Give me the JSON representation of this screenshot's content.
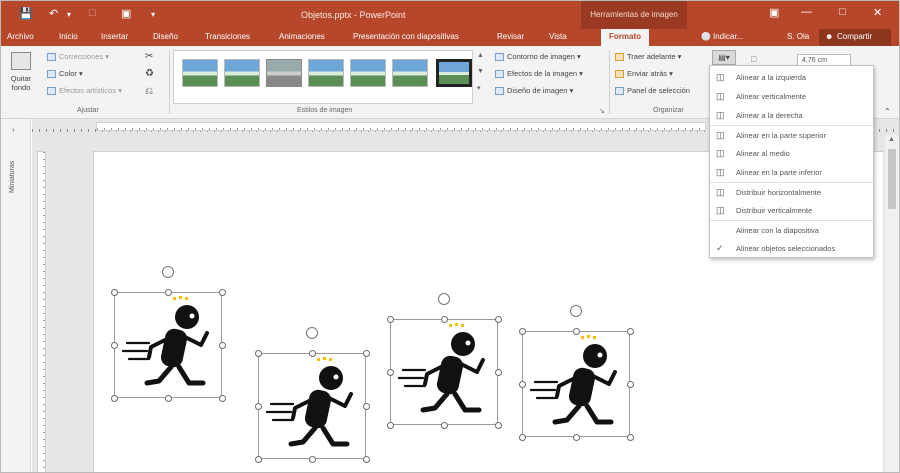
{
  "titlebar": {
    "doc_title": "Objetos.pptx - PowerPoint",
    "tools_tab": "Herramientas de imagen",
    "save_icon": "save-icon",
    "undo_icon": "undo-icon"
  },
  "tabs": [
    "Archivo",
    "Inicio",
    "Insertar",
    "Diseño",
    "Transiciones",
    "Animaciones",
    "Presentación con diapositivas",
    "Revisar",
    "Vista",
    "Formato"
  ],
  "tell_me": "Indicar...",
  "user": "S. Ola",
  "share": "Compartir",
  "ribbon": {
    "adjust": {
      "remove_bg": "Quitar fondo",
      "corrections": "Correcciones",
      "color": "Color",
      "effects": "Efectos artísticos",
      "group_label": "Ajustar"
    },
    "styles": {
      "group_label": "Estilos de imagen",
      "border": "Contorno de imagen",
      "effects": "Efectos de la imagen",
      "layout": "Diseño de imagen"
    },
    "arrange": {
      "forward": "Traer adelante",
      "backward": "Enviar atrás",
      "selection_pane": "Panel de selección",
      "group_label": "Organizar"
    },
    "size_value": "4,76 cm"
  },
  "sidebar_label": "Miniaturas",
  "align_menu": {
    "items": [
      {
        "label": "Alinear a la izquierda",
        "icon": "align-left-icon"
      },
      {
        "label": "Alinear verticalmente",
        "icon": "align-center-icon"
      },
      {
        "label": "Alinear a la derecha",
        "icon": "align-right-icon"
      },
      {
        "label": "Alinear en la parte superior",
        "icon": "align-top-icon"
      },
      {
        "label": "Alinear al medio",
        "icon": "align-middle-icon"
      },
      {
        "label": "Alinear en la parte inferior",
        "icon": "align-bottom-icon"
      },
      {
        "label": "Distribuir horizontalmente",
        "icon": "distribute-horizontal-icon"
      },
      {
        "label": "Distribuir verticalmente",
        "icon": "distribute-vertical-icon"
      },
      {
        "label": "Alinear con la diapositiva",
        "icon": ""
      },
      {
        "label": "Alinear objetos seleccionados",
        "icon": "checkmark-icon"
      }
    ]
  }
}
